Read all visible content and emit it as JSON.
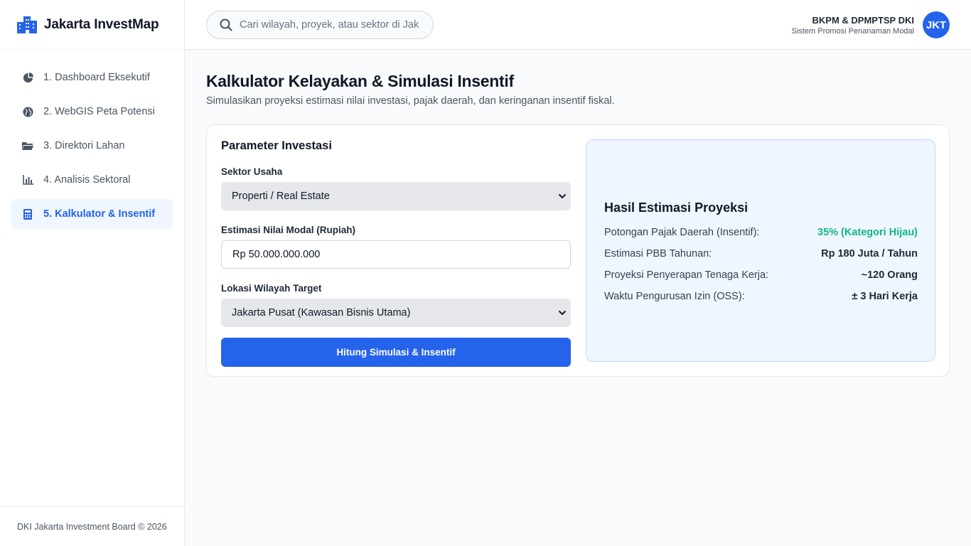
{
  "app": {
    "name": "Jakarta InvestMap"
  },
  "sidebar": {
    "items": [
      {
        "label": "1. Dashboard Eksekutif",
        "icon": "pie-chart-icon",
        "active": false
      },
      {
        "label": "2. WebGIS Peta Potensi",
        "icon": "globe-icon",
        "active": false
      },
      {
        "label": "3. Direktori Lahan",
        "icon": "folder-open-icon",
        "active": false
      },
      {
        "label": "4. Analisis Sektoral",
        "icon": "bar-chart-icon",
        "active": false
      },
      {
        "label": "5. Kalkulator & Insentif",
        "icon": "calculator-icon",
        "active": true
      }
    ],
    "footer": "DKI Jakarta Investment Board © 2026"
  },
  "topbar": {
    "search_placeholder": "Cari wilayah, proyek, atau sektor di Jakarta...",
    "org": "BKPM & DPMPTSP DKI",
    "org_sub": "Sistem Promosi Penanaman Modal",
    "avatar": "JKT"
  },
  "page": {
    "title": "Kalkulator Kelayakan & Simulasi Insentif",
    "subtitle": "Simulasikan proyeksi estimasi nilai investasi, pajak daerah, dan keringanan insentif fiskal."
  },
  "form": {
    "title": "Parameter Investasi",
    "sector_label": "Sektor Usaha",
    "sector_value": "Properti / Real Estate",
    "capital_label": "Estimasi Nilai Modal (Rupiah)",
    "capital_value": "Rp 50.000.000.000",
    "location_label": "Lokasi Wilayah Target",
    "location_value": "Jakarta Pusat (Kawasan Bisnis Utama)",
    "submit_label": "Hitung Simulasi & Insentif"
  },
  "result": {
    "title": "Hasil Estimasi Proyeksi",
    "rows": [
      {
        "key": "Potongan Pajak Daerah (Insentif):",
        "value": "35% (Kategori Hijau)"
      },
      {
        "key": "Estimasi PBB Tahunan:",
        "value": "Rp 180 Juta / Tahun"
      },
      {
        "key": "Proyeksi Penyerapan Tenaga Kerja:",
        "value": "~120 Orang"
      },
      {
        "key": "Waktu Pengurusan Izin (OSS):",
        "value": "± 3 Hari Kerja"
      }
    ]
  },
  "colors": {
    "accent": "#2563eb",
    "success": "#10b981",
    "result_bg": "#eff6ff"
  }
}
